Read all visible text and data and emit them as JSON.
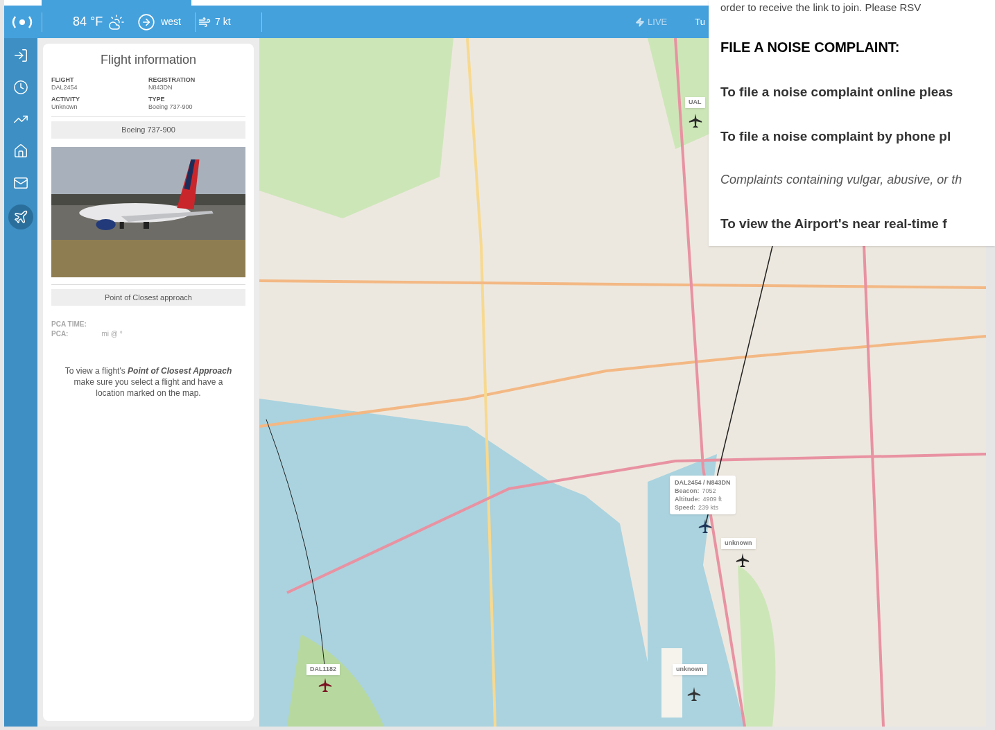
{
  "top_bar": {
    "temperature": "84 °F",
    "wind_direction": "west",
    "wind_speed": "7 kt",
    "live_label": "LIVE",
    "cut_label": "Tu"
  },
  "sidebar": {
    "items": [
      {
        "kind": "login",
        "selected": false
      },
      {
        "kind": "clock",
        "selected": false
      },
      {
        "kind": "chart",
        "selected": false
      },
      {
        "kind": "home",
        "selected": false
      },
      {
        "kind": "mail",
        "selected": false
      },
      {
        "kind": "plane",
        "selected": true
      }
    ]
  },
  "flight_panel": {
    "title": "Flight information",
    "fields": [
      {
        "label": "FLIGHT",
        "value": "DAL2454"
      },
      {
        "label": "REGISTRATION",
        "value": "N843DN"
      },
      {
        "label": "ACTIVITY",
        "value": "Unknown"
      },
      {
        "label": "TYPE",
        "value": "Boeing 737-900"
      }
    ],
    "type_header": "Boeing 737-900",
    "pca_header": "Point of Closest approach",
    "pca_fields": [
      {
        "label": "PCA TIME:"
      },
      {
        "label": "PCA:",
        "value": "mi @ °"
      }
    ],
    "hint": "To view a flight's **Point of Closest Approach** make sure you select a flight and have a location marked on the map."
  },
  "map": {
    "aircraft": [
      {
        "kind": "tooltip",
        "callsign": "DAL2454 / N843DN",
        "details": [
          {
            "label": "Beacon:",
            "value": "7052"
          },
          {
            "label": "Altitude:",
            "value": "4909 ft"
          },
          {
            "label": "Speed:",
            "value": "239 kts"
          }
        ],
        "color": "#1e3557"
      },
      {
        "kind": "tag",
        "callsign": "unknown",
        "color": "#222222"
      },
      {
        "kind": "tag",
        "callsign": "unknown",
        "color": "#333333"
      },
      {
        "kind": "tag",
        "callsign": "DAL1182",
        "color": "#7a1020"
      },
      {
        "kind": "tag",
        "callsign": "UAL",
        "color": "#2a2a2a"
      }
    ]
  },
  "popup": {
    "cut_text": "order to receive the link to join. Please RSV",
    "heading": "FILE A NOISE COMPLAINT:",
    "paragraphs": [
      {
        "kind": "bold",
        "text": "To file a noise complaint online pleas"
      },
      {
        "kind": "bold",
        "text": "To file a noise complaint by phone pl"
      },
      {
        "kind": "note",
        "text": "Complaints containing vulgar, abusive, or th"
      },
      {
        "kind": "bold",
        "text": "To view the Airport's near real-time f"
      }
    ]
  }
}
